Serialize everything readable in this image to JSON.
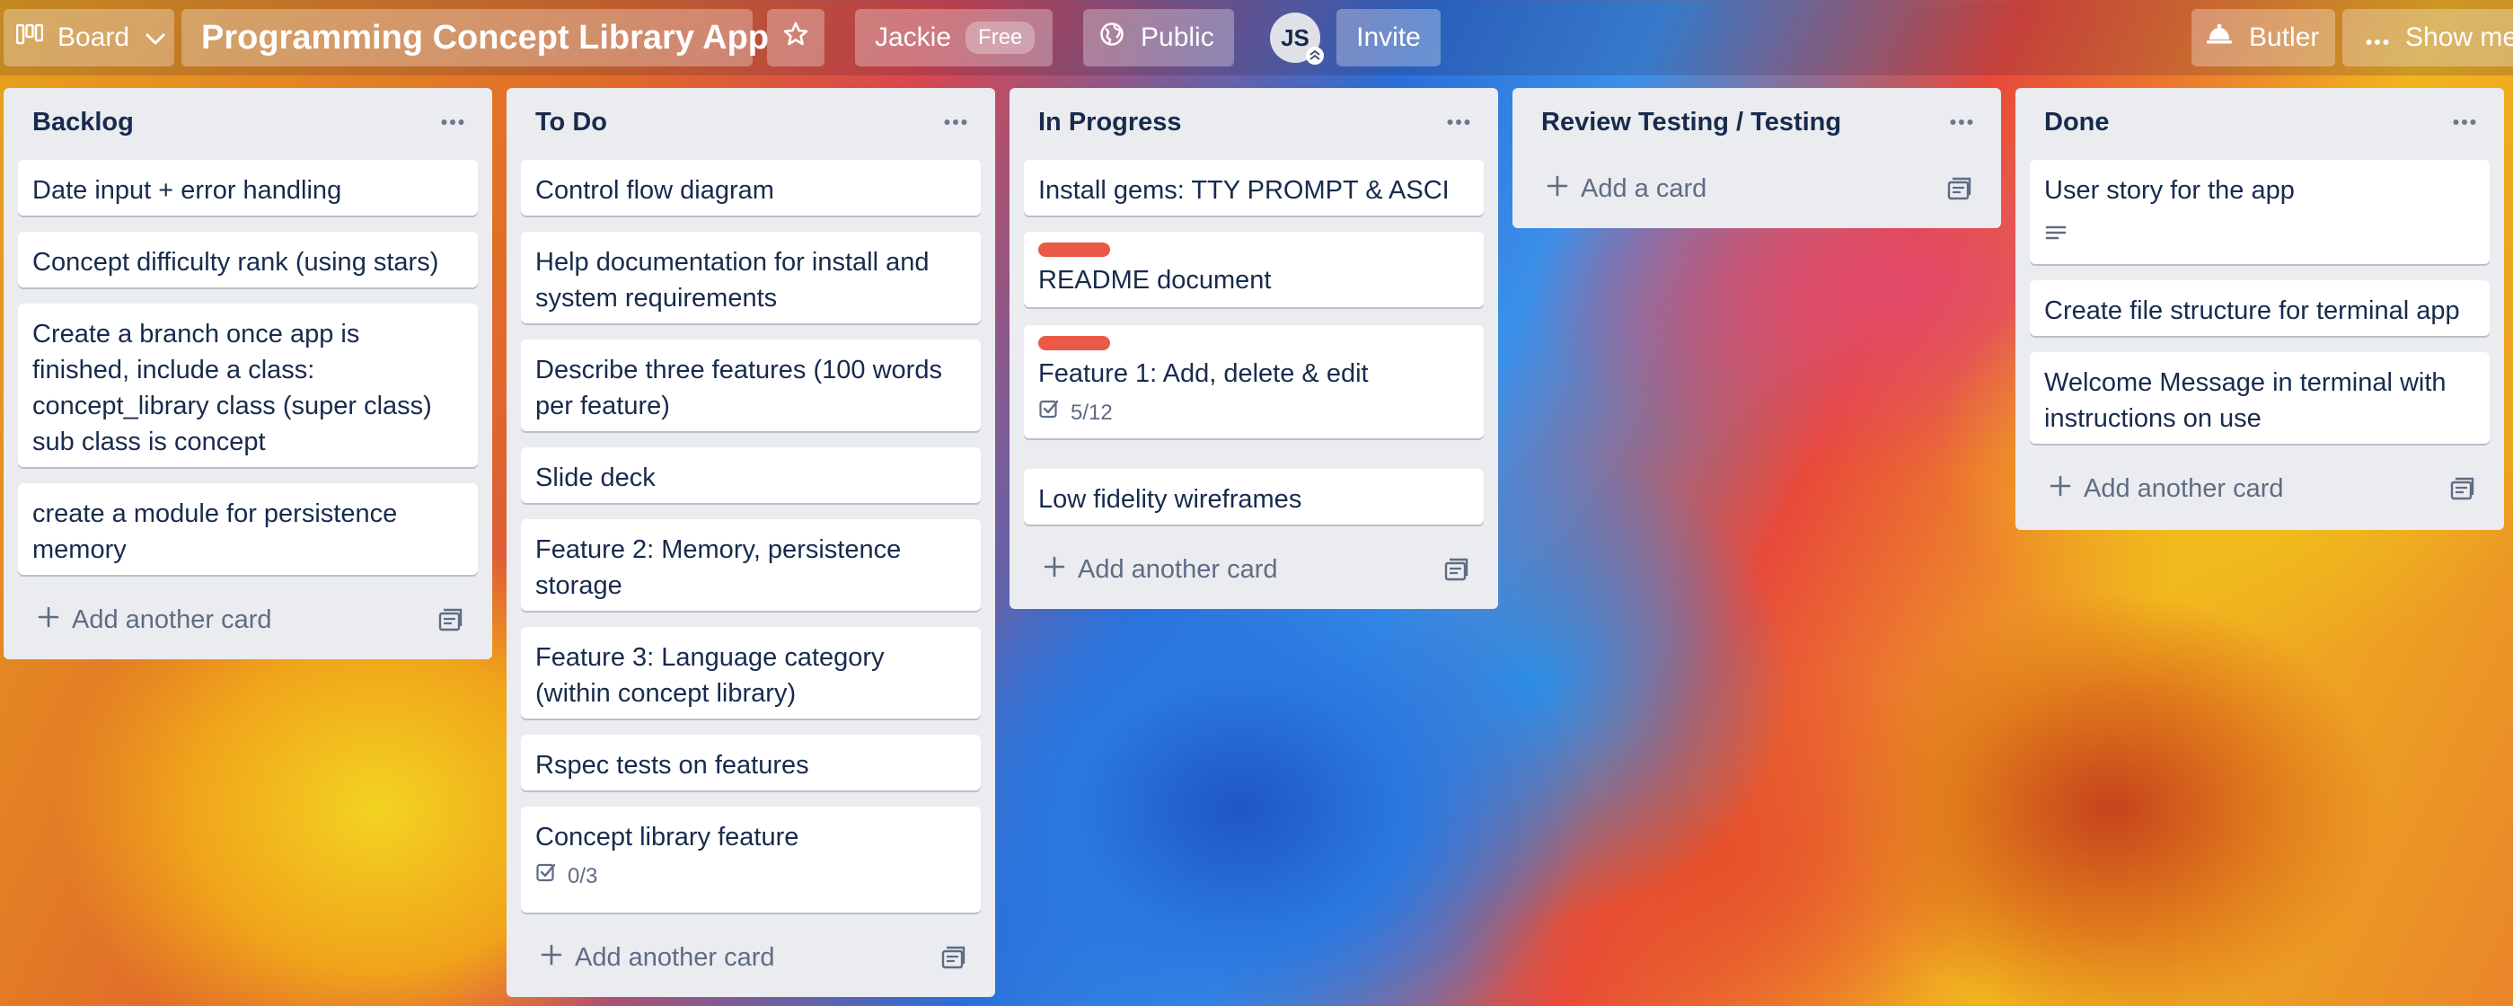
{
  "header": {
    "board_view_label": "Board",
    "board_title": "Programming Concept Library App",
    "workspace_name": "Jackie",
    "workspace_badge": "Free",
    "visibility_label": "Public",
    "member_initials": "JS",
    "invite_label": "Invite",
    "butler_label": "Butler",
    "show_menu_label": "Show me"
  },
  "lists": [
    {
      "title": "Backlog",
      "cards": [
        {
          "text": "Date input + error handling"
        },
        {
          "text": "Concept difficulty rank (using stars)"
        },
        {
          "text": "Create a branch once app is finished, include a class: concept_library class (super class) sub class is concept"
        },
        {
          "text": "create a module for persistence memory"
        }
      ],
      "add_label": "Add another card"
    },
    {
      "title": "To Do",
      "cards": [
        {
          "text": "Control flow diagram"
        },
        {
          "text": "Help documentation for install and system requirements"
        },
        {
          "text": "Describe three features (100 words per feature)"
        },
        {
          "text": "Slide deck"
        },
        {
          "text": "Feature 2: Memory, persistence storage"
        },
        {
          "text": "Feature 3: Language category (within concept library)"
        },
        {
          "text": "Rspec tests on features"
        },
        {
          "text": "Concept library feature",
          "checklist": "0/3"
        }
      ],
      "add_label": "Add another card"
    },
    {
      "title": "In Progress",
      "cards": [
        {
          "text": "Install gems: TTY PROMPT & ASCI"
        },
        {
          "text": "README document",
          "label_color": "#eb5a46"
        },
        {
          "text": "Feature 1: Add, delete & edit",
          "label_color": "#eb5a46",
          "checklist": "5/12"
        },
        {
          "text": "Low fidelity wireframes"
        }
      ],
      "add_label": "Add another card"
    },
    {
      "title": "Review Testing / Testing",
      "cards": [],
      "add_label": "Add a card"
    },
    {
      "title": "Done",
      "cards": [
        {
          "text": "User story for the app",
          "has_description": true
        },
        {
          "text": "Create file structure for terminal app"
        },
        {
          "text": "Welcome Message in terminal with instructions on use"
        }
      ],
      "add_label": "Add another card"
    }
  ],
  "colors": {
    "list_background": "#ebecf0",
    "card_text": "#172b4d",
    "muted_text": "#5e6c84",
    "red_label": "#eb5a46"
  }
}
